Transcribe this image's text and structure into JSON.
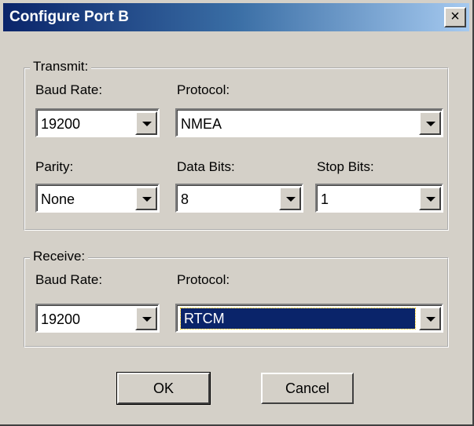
{
  "window": {
    "title": "Configure Port B",
    "close_label": "×"
  },
  "transmit": {
    "legend": "Transmit:",
    "baud_label": "Baud Rate:",
    "baud_value": "19200",
    "protocol_label": "Protocol:",
    "protocol_value": "NMEA",
    "parity_label": "Parity:",
    "parity_value": "None",
    "databits_label": "Data Bits:",
    "databits_value": "8",
    "stopbits_label": "Stop Bits:",
    "stopbits_value": "1"
  },
  "receive": {
    "legend": "Receive:",
    "baud_label": "Baud Rate:",
    "baud_value": "19200",
    "protocol_label": "Protocol:",
    "protocol_value": "RTCM"
  },
  "buttons": {
    "ok": "OK",
    "cancel": "Cancel"
  },
  "colors": {
    "titlebar_start": "#0a246a",
    "selection": "#0a246a",
    "face": "#d4d0c8"
  },
  "icons": {
    "close": "close-icon",
    "dropdown": "chevron-down-icon"
  }
}
